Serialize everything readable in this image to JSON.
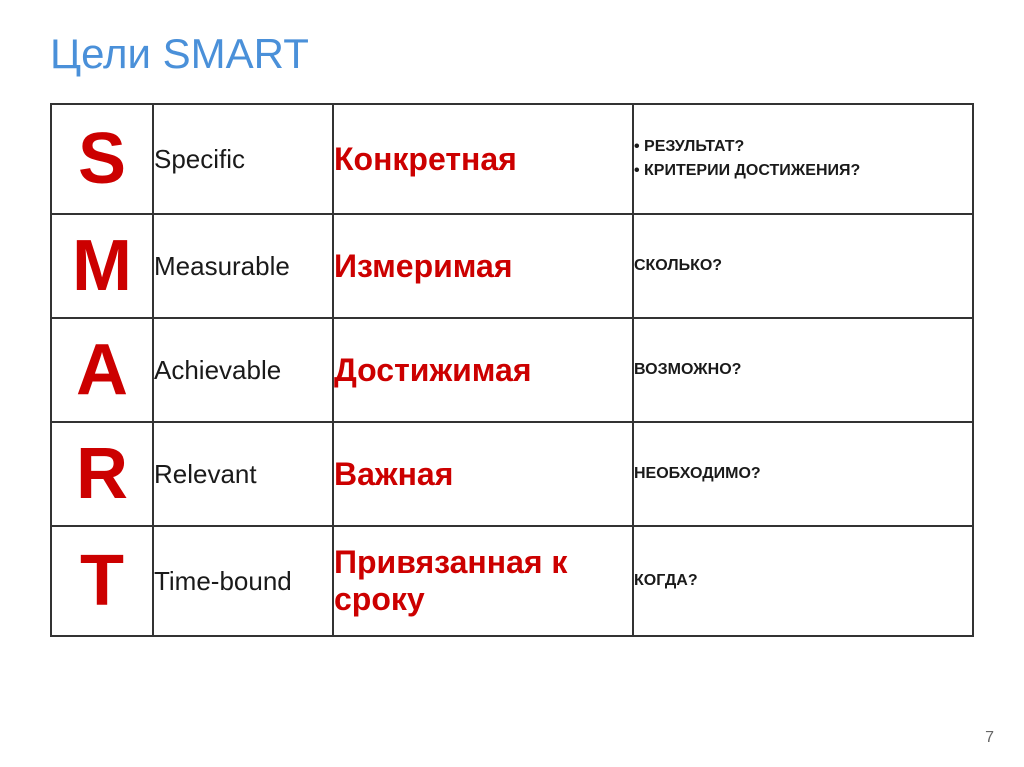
{
  "page": {
    "title": "Цели SMART",
    "page_number": "7"
  },
  "rows": [
    {
      "letter": "S",
      "english": "Specific",
      "russian": "Конкретная",
      "question": "• РЕЗУЛЬТАТ?\n• КРИТЕРИИ ДОСТИЖЕНИЯ?"
    },
    {
      "letter": "M",
      "english": "Measurable",
      "russian": "Измеримая",
      "question": "СКОЛЬКО?"
    },
    {
      "letter": "A",
      "english": "Achievable",
      "russian": "Достижимая",
      "question": "ВОЗМОЖНО?"
    },
    {
      "letter": "R",
      "english": "Relevant",
      "russian": "Важная",
      "question": "НЕОБХОДИМО?"
    },
    {
      "letter": "T",
      "english": "Time-bound",
      "russian": "Привязанная к сроку",
      "question": "КОГДА?"
    }
  ]
}
